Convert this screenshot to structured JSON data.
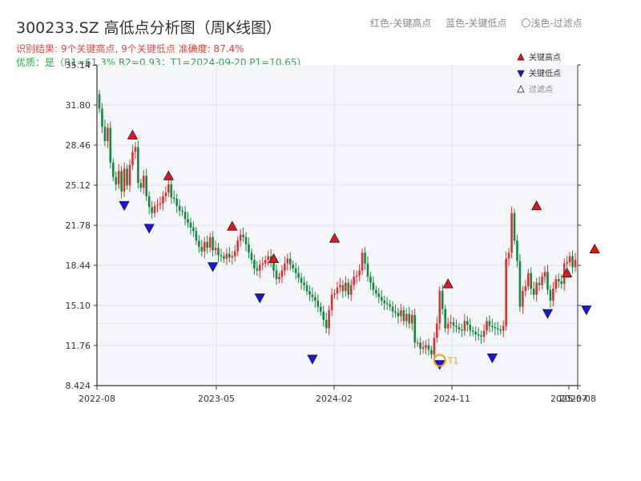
{
  "header": {
    "title": "300233.SZ 高低点分析图（周K线图）",
    "legend_red": "红色-关键高点",
    "legend_blue": "蓝色-关键低点",
    "legend_light": "〇浅色-过滤点",
    "result_line": "识别结果: 9个关键高点, 9个关键低点  准确度: 87.4%",
    "quality_line": "优质：是（R1=61.3%  R2=0.93；T1=2024-09-20 P1=10.65）"
  },
  "chart_data": {
    "type": "candlestick",
    "ylim": [
      8.424,
      35.14
    ],
    "ytick_labels": [
      "35.14",
      "31.80",
      "28.46",
      "25.12",
      "21.78",
      "18.44",
      "15.10",
      "11.76",
      "8.424"
    ],
    "xtick_labels": [
      "2022-08",
      "2023-05",
      "2024-02",
      "2024-11",
      "2025-07",
      "2025-08"
    ],
    "closes": [
      31.5,
      30.0,
      28.8,
      29.9,
      27.0,
      25.8,
      25.2,
      26.3,
      24.6,
      26.5,
      25.1,
      26.8,
      27.9,
      28.3,
      25.3,
      24.9,
      25.9,
      24.2,
      23.3,
      22.8,
      23.4,
      23.5,
      23.6,
      24.2,
      24.5,
      25.2,
      24.1,
      24.0,
      23.4,
      23.0,
      22.9,
      22.3,
      22.0,
      21.6,
      21.3,
      20.5,
      20.0,
      19.6,
      20.4,
      19.9,
      20.8,
      19.7,
      19.9,
      19.3,
      19.2,
      19.0,
      19.4,
      19.1,
      19.2,
      19.6,
      20.5,
      21.0,
      20.8,
      20.2,
      19.5,
      18.9,
      18.2,
      18.0,
      18.5,
      18.6,
      18.9,
      19.2,
      18.7,
      18.0,
      17.3,
      17.5,
      18.0,
      18.6,
      19.0,
      18.5,
      18.2,
      17.8,
      17.4,
      17.0,
      16.8,
      16.3,
      16.0,
      15.8,
      15.5,
      15.0,
      14.6,
      13.9,
      13.2,
      14.7,
      16.0,
      16.1,
      16.6,
      16.8,
      16.3,
      17.0,
      16.0,
      16.8,
      17.5,
      17.6,
      18.0,
      19.5,
      18.6,
      17.5,
      17.0,
      16.4,
      16.1,
      15.8,
      15.5,
      15.3,
      15.2,
      15.0,
      14.6,
      14.5,
      14.2,
      14.7,
      13.8,
      14.4,
      13.6,
      14.3,
      12.0,
      12.0,
      11.5,
      11.6,
      11.8,
      11.4,
      11.0,
      12.4,
      13.6,
      16.3,
      14.8,
      13.2,
      13.6,
      13.7,
      13.4,
      13.3,
      13.1,
      13.0,
      13.8,
      13.5,
      13.0,
      12.9,
      12.7,
      12.6,
      12.5,
      13.0,
      13.8,
      13.4,
      13.3,
      13.2,
      13.1,
      13.0,
      13.4,
      19.0,
      19.5,
      22.8,
      20.5,
      18.8,
      15.0,
      16.3,
      16.7,
      17.8,
      16.5,
      16.0,
      17.0,
      16.8,
      17.5,
      17.9,
      16.4,
      15.5,
      16.5,
      17.3,
      17.1,
      16.9,
      18.6,
      18.7,
      19.2,
      18.3,
      18.9
    ],
    "key_highs": [
      {
        "week": 12,
        "value": 28.7
      },
      {
        "week": 25,
        "value": 25.3
      },
      {
        "week": 48,
        "value": 21.1
      },
      {
        "week": 63,
        "value": 18.4
      },
      {
        "week": 85,
        "value": 20.1
      },
      {
        "week": 126,
        "value": 16.3
      },
      {
        "week": 158,
        "value": 22.8
      },
      {
        "week": 169,
        "value": 17.2
      },
      {
        "week": 179,
        "value": 19.2
      }
    ],
    "key_lows": [
      {
        "week": 9,
        "value": 23.9
      },
      {
        "week": 18,
        "value": 22.0
      },
      {
        "week": 41,
        "value": 18.8
      },
      {
        "week": 58,
        "value": 16.2
      },
      {
        "week": 77,
        "value": 11.1
      },
      {
        "week": 123,
        "value": 10.65
      },
      {
        "week": 142,
        "value": 11.2
      },
      {
        "week": 162,
        "value": 14.9
      },
      {
        "week": 176,
        "value": 15.2
      }
    ],
    "t1_marker": {
      "week": 123,
      "value": 10.65,
      "label": "T1"
    },
    "legend": [
      "关键高点",
      "关键低点",
      "过滤点"
    ],
    "colors": {
      "up": "#e03030",
      "down": "#138a3c",
      "high": "#e8141c",
      "low": "#1515e8",
      "t1": "#f39c12",
      "grid": "#e1e6ed",
      "axis": "#333333"
    }
  }
}
